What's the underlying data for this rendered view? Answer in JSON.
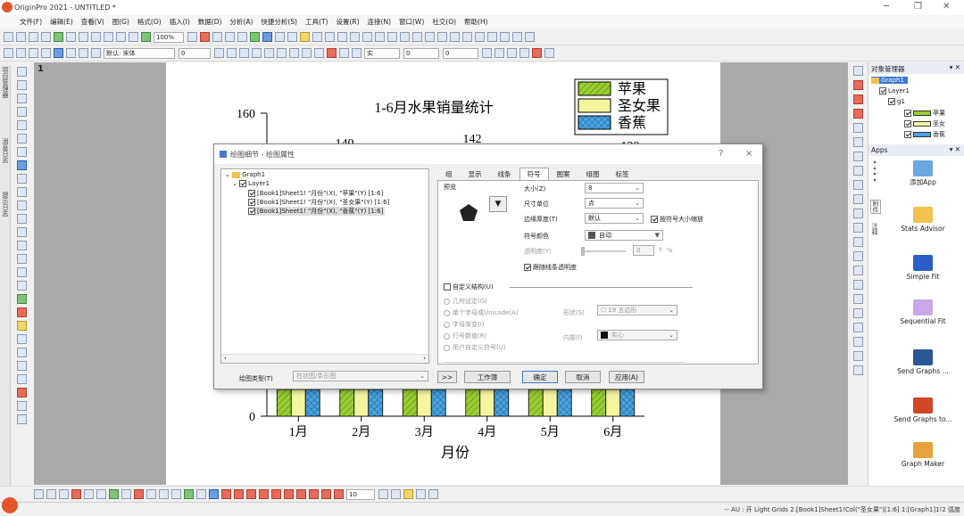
{
  "window": {
    "title": "OriginPro 2021 - UNTITLED *"
  },
  "menu": [
    "文件(F)",
    "编辑(E)",
    "查看(V)",
    "图(G)",
    "格式(O)",
    "插入(I)",
    "数据(D)",
    "分析(A)",
    "快捷分析(S)",
    "工具(T)",
    "设置(R)",
    "连接(N)",
    "窗口(W)",
    "社交(O)",
    "帮助(H)"
  ],
  "toolbar": {
    "zoom": "100%",
    "font": "默认: 宋体",
    "size1": "0",
    "size2": "0",
    "size3": "0",
    "line_style": "实"
  },
  "left_strip_labels": [
    "项目管理器",
    "消息日志",
    "提示日志"
  ],
  "graph": {
    "page_number": "1"
  },
  "chart_data": {
    "type": "bar",
    "title": "1-6月水果销量统计",
    "xlabel": "月份",
    "ylabel": "",
    "categories": [
      "1月",
      "2月",
      "3月",
      "4月",
      "5月",
      "6月"
    ],
    "ylim": [
      0,
      160
    ],
    "yticks": [
      "0",
      "160"
    ],
    "visible_labels": [
      "140",
      "142",
      "120"
    ],
    "legend_position": "top-right",
    "series": [
      {
        "name": "苹果",
        "color": "#9acd32",
        "pattern": "diagonal"
      },
      {
        "name": "圣女果",
        "color": "#f5f5a0",
        "pattern": "solid"
      },
      {
        "name": "香蕉",
        "color": "#4aa3df",
        "pattern": "diagonal-cross"
      }
    ]
  },
  "dialog": {
    "title": "绘图细节 - 绘图属性",
    "help": "?",
    "close": "×",
    "tree": {
      "root": "Graph1",
      "layer": "Layer1",
      "items": [
        "[Book1]Sheet1! \"月份\"(X), \"苹果\"(Y) [1:6]",
        "[Book1]Sheet1! \"月份\"(X), \"圣女果\"(Y) [1:6]",
        "[Book1]Sheet1! \"月份\"(X), \"香蕉\"(Y) [1:6]"
      ]
    },
    "tabs": [
      "组",
      "显示",
      "线条",
      "符号",
      "图案",
      "组图",
      "标签"
    ],
    "active_tab": "符号",
    "preview_label": "预览",
    "size_label": "大小(Z)",
    "size_value": "8",
    "unit_label": "尺寸单位",
    "unit_value": "点",
    "edge_label": "边缘厚度(T)",
    "edge_value": "默认",
    "scale_check_label": "按符号大小缩放",
    "color_label": "符号颜色",
    "color_value": "自动",
    "transparency_label": "透明度(Y)",
    "transparency_value": "0",
    "percent": "%",
    "follow_line_label": "跟随线条透明度",
    "custom_struct_label": "自定义结构(U)",
    "radios": [
      "几何设定(G)",
      "单个字母或Unicode(A)",
      "字母渐变(I)",
      "行号数值(R)",
      "用户自定义符号(U)"
    ],
    "shape_label": "形状(S)",
    "shape_value": "19 五边形",
    "interior_label": "内部(I)",
    "interior_value": "实心",
    "plot_type_label": "绘图类型(T)",
    "plot_type_value": "柱状图/条形图",
    "btn_more": ">>",
    "btn_workbook": "工作簿",
    "btn_ok": "确定",
    "btn_cancel": "取消",
    "btn_apply": "应用(A)"
  },
  "object_manager": {
    "title": "对象管理器",
    "graph": "Graph1",
    "layer": "Layer1",
    "group": "g1",
    "series": [
      "苹果",
      "圣女",
      "香蕉"
    ]
  },
  "apps": {
    "title": "Apps",
    "side_tabs": [
      "附件",
      "注释"
    ],
    "items": [
      "添加App",
      "Stats Advisor",
      "Simple Fit",
      "Sequential Fit",
      "Send Graphs ...",
      "Send Graphs to...",
      "Graph Maker"
    ]
  },
  "bottom_toolbar": {
    "size": "10"
  },
  "status_bar": "-- AU : 开 Light Grids 2:[Book1]Sheet1!Col(\"圣女果\")[1:6] 1:[Graph1]1!2 弧度"
}
